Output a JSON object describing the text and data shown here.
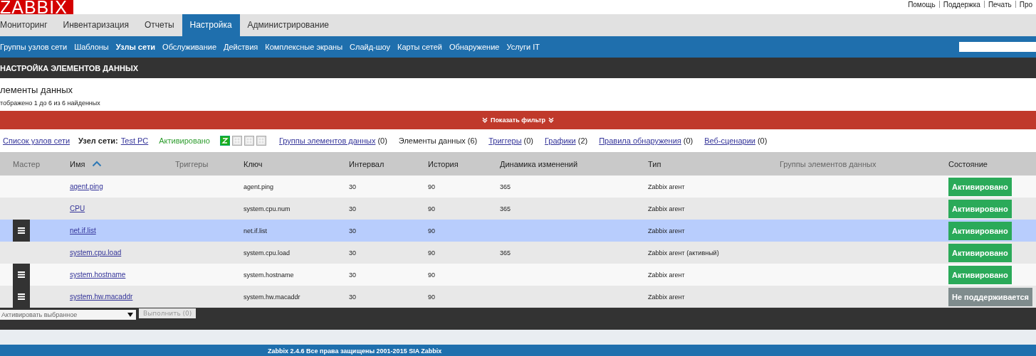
{
  "logo": "ZABBIX",
  "top_links": [
    "Помощь",
    "Поддержка",
    "Печать",
    "Про"
  ],
  "main_menu": [
    {
      "label": "Мониторинг",
      "selected": false
    },
    {
      "label": "Инвентаризация",
      "selected": false
    },
    {
      "label": "Отчеты",
      "selected": false
    },
    {
      "label": "Настройка",
      "selected": true
    },
    {
      "label": "Администрирование",
      "selected": false
    }
  ],
  "sub_menu": [
    {
      "label": "Группы узлов сети",
      "selected": false
    },
    {
      "label": "Шаблоны",
      "selected": false
    },
    {
      "label": "Узлы сети",
      "selected": true
    },
    {
      "label": "Обслуживание",
      "selected": false
    },
    {
      "label": "Действия",
      "selected": false
    },
    {
      "label": "Комплексные экраны",
      "selected": false
    },
    {
      "label": "Слайд-шоу",
      "selected": false
    },
    {
      "label": "Карты сетей",
      "selected": false
    },
    {
      "label": "Обнаружение",
      "selected": false
    },
    {
      "label": "Услуги IT",
      "selected": false
    }
  ],
  "page_header": "НАСТРОЙКА ЭЛЕМЕНТОВ ДАННЫХ",
  "section_title": "лементы данных",
  "found_count": "тображено 1 до 6 из 6 найденных",
  "filter_toggle": "Показать фильтр",
  "host_bar": {
    "host_list_link": "Список узлов сети",
    "host_label": "Узел сети:",
    "host_link": "Test PC",
    "host_status": "Активировано",
    "links": [
      {
        "label": "Группы элементов данных",
        "count": "(0)",
        "kind": "link"
      },
      {
        "label": "Элементы данных",
        "count": "(6)",
        "kind": "current"
      },
      {
        "label": "Триггеры",
        "count": "(0)",
        "kind": "link"
      },
      {
        "label": "Графики",
        "count": "(2)",
        "kind": "link"
      },
      {
        "label": "Правила обнаружения",
        "count": "(0)",
        "kind": "link"
      },
      {
        "label": "Веб-сценарии",
        "count": "(0)",
        "kind": "link"
      }
    ]
  },
  "table": {
    "columns": [
      {
        "label": "Мастер",
        "muted": true
      },
      {
        "label": "Имя",
        "muted": false,
        "sorted": true
      },
      {
        "label": "Триггеры",
        "muted": true
      },
      {
        "label": "Ключ",
        "muted": false
      },
      {
        "label": "Интервал",
        "muted": false
      },
      {
        "label": "История",
        "muted": false
      },
      {
        "label": "Динамика изменений",
        "muted": false
      },
      {
        "label": "Тип",
        "muted": false
      },
      {
        "label": "Группы элементов данных",
        "muted": true
      },
      {
        "label": "Состояние",
        "muted": false
      }
    ],
    "rows": [
      {
        "master_menu": false,
        "name": "agent.ping",
        "key": "agent.ping",
        "interval": "30",
        "history": "90",
        "trends": "365",
        "type": "Zabbix агент",
        "status": "Активировано",
        "kind": "enabled",
        "selected": false
      },
      {
        "master_menu": false,
        "name": "CPU",
        "key": "system.cpu.num",
        "interval": "30",
        "history": "90",
        "trends": "365",
        "type": "Zabbix агент",
        "status": "Активировано",
        "kind": "enabled",
        "selected": false
      },
      {
        "master_menu": true,
        "name": "net.if.list",
        "key": "net.if.list",
        "interval": "30",
        "history": "90",
        "trends": "",
        "type": "Zabbix агент",
        "status": "Активировано",
        "kind": "enabled",
        "selected": true
      },
      {
        "master_menu": false,
        "name": "system.cpu.load",
        "key": "system.cpu.load",
        "interval": "30",
        "history": "90",
        "trends": "365",
        "type": "Zabbix агент (активный)",
        "status": "Активировано",
        "kind": "enabled",
        "selected": false
      },
      {
        "master_menu": true,
        "name": "system.hostname",
        "key": "system.hostname",
        "interval": "30",
        "history": "90",
        "trends": "",
        "type": "Zabbix агент",
        "status": "Активировано",
        "kind": "enabled",
        "selected": false
      },
      {
        "master_menu": true,
        "name": "system.hw.macaddr",
        "key": "system.hw.macaddr",
        "interval": "30",
        "history": "90",
        "trends": "",
        "type": "Zabbix агент",
        "status": "Не поддерживается",
        "kind": "unsupported",
        "selected": false
      }
    ]
  },
  "action_select": "Активировать выбранное",
  "action_button": {
    "label": "Выполнить (0)",
    "disabled": true
  },
  "footer": "Zabbix 2.4.6 Все права защищены 2001-2015 SIA Zabbix"
}
